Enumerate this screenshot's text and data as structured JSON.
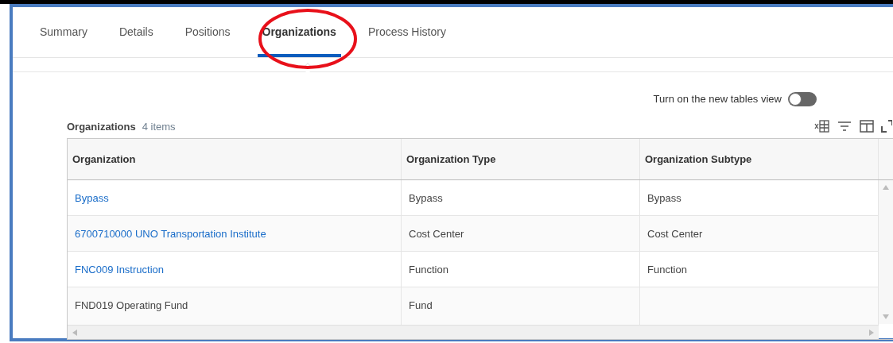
{
  "tabs": [
    {
      "label": "Summary",
      "selected": false
    },
    {
      "label": "Details",
      "selected": false
    },
    {
      "label": "Positions",
      "selected": false
    },
    {
      "label": "Organizations",
      "selected": true
    },
    {
      "label": "Process History",
      "selected": false
    }
  ],
  "toggle": {
    "label": "Turn on the new tables view",
    "on": false
  },
  "table": {
    "title": "Organizations",
    "count": "4 items",
    "columns": [
      "Organization",
      "Organization Type",
      "Organization Subtype"
    ],
    "rows": [
      {
        "cells": [
          "Bypass",
          "Bypass",
          "Bypass"
        ],
        "link": true
      },
      {
        "cells": [
          "6700710000 UNO Transportation Institute",
          "Cost Center",
          "Cost Center"
        ],
        "link": true
      },
      {
        "cells": [
          "FNC009 Instruction",
          "Function",
          "Function"
        ],
        "link": true
      },
      {
        "cells": [
          "FND019 Operating Fund",
          "Fund",
          null
        ],
        "link": false
      }
    ]
  }
}
